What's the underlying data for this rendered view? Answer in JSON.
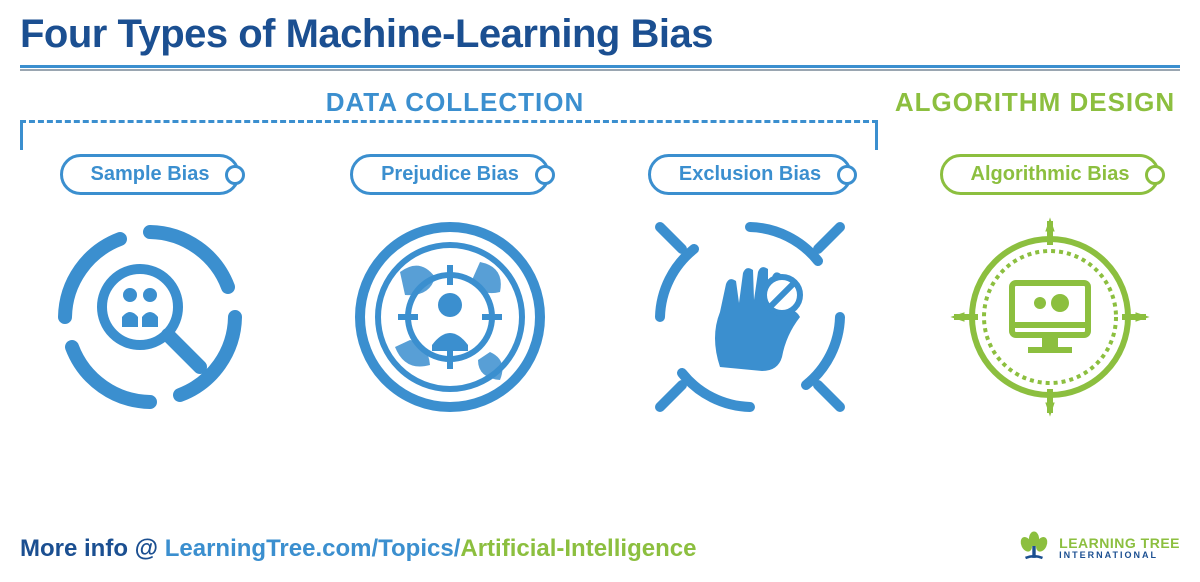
{
  "title": "Four Types of Machine-Learning Bias",
  "sections": {
    "data_collection": "DATA COLLECTION",
    "algorithm_design": "ALGORITHM DESIGN"
  },
  "biases": [
    {
      "label": "Sample Bias",
      "category": "data_collection",
      "icon": "magnifier-people-icon"
    },
    {
      "label": "Prejudice Bias",
      "category": "data_collection",
      "icon": "globe-target-person-icon"
    },
    {
      "label": "Exclusion Bias",
      "category": "data_collection",
      "icon": "hand-stop-icon"
    },
    {
      "label": "Algorithmic Bias",
      "category": "algorithm_design",
      "icon": "computer-gear-icon"
    }
  ],
  "footer": {
    "prefix": "More info @ ",
    "url_part1": "LearningTree.com/Topics/",
    "url_part2": "Artificial-Intelligence"
  },
  "logo": {
    "line1": "LEARNING TREE",
    "line2": "INTERNATIONAL"
  },
  "colors": {
    "primary_blue": "#3b8fcf",
    "dark_blue": "#1b4f91",
    "green": "#8cbf3f"
  }
}
